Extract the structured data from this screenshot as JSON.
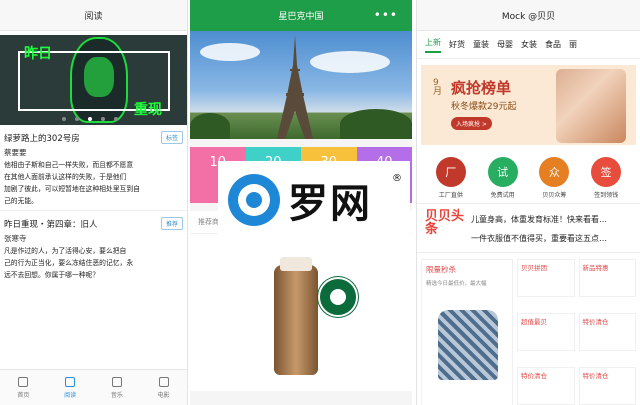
{
  "reader": {
    "title": "阅读",
    "banner": {
      "text_left": "昨日",
      "text_right": "重现"
    },
    "articles": [
      {
        "title": "绿萝路上的302号房",
        "tag": "标签",
        "author": "蔡要要",
        "lines": [
          "他相由子斯和自己一样失败，而且都不愿意",
          "在其他人面前承认这样的失败，于是他们",
          "加剧了彼此，可以短暂地在这种相处里互到自",
          "己的无能。"
        ]
      },
      {
        "title": "昨日重现・第四章：旧人",
        "tag": "推荐",
        "author": "张寒寺",
        "lines": [
          "凡是作过的人，为了活得心安，要么把自",
          "己的行为正当化，要么冻结住恶的记忆，永",
          "远不去回想。你属于哪一种呢？"
        ]
      }
    ],
    "tabs": [
      "首页",
      "阅读",
      "音乐",
      "电影"
    ]
  },
  "starbucks": {
    "title": "星巴克中国",
    "cards": [
      "10",
      "20",
      "30",
      "40"
    ],
    "rec_label": "推荐商品",
    "logo_text": "STARBUCKS COFFEE"
  },
  "mock": {
    "title": "Mock @贝贝",
    "nav": [
      "上新",
      "好货",
      "童装",
      "母婴",
      "女装",
      "食品",
      "丽"
    ],
    "promo": {
      "month": "9月",
      "title": "疯抢榜单",
      "sub": "秋冬爆款29元起",
      "btn": "入场疯抢 >"
    },
    "icons": [
      {
        "label": "工厂直供",
        "color": "#c0392b",
        "glyph": "厂"
      },
      {
        "label": "免费试用",
        "color": "#27ae60",
        "glyph": "试"
      },
      {
        "label": "贝贝众筹",
        "color": "#e67e22",
        "glyph": "众"
      },
      {
        "label": "签到领钱",
        "color": "#e74c3c",
        "glyph": "签"
      }
    ],
    "headline": {
      "logo": "贝贝头条",
      "line1": "儿童身高，体重发育标准！快来看看…",
      "line2": "一件衣服值不值得买，重要看这五点…"
    },
    "grid": {
      "left_title": "限量秒杀",
      "left_sub": "精选今日最低价，最大幅",
      "cells": [
        "贝贝拼团",
        "新品特惠",
        "超值最贝",
        "特价清仓",
        "特价清仓",
        "特价清仓"
      ]
    }
  },
  "overlay": {
    "text": "罗网",
    "reg": "®"
  }
}
